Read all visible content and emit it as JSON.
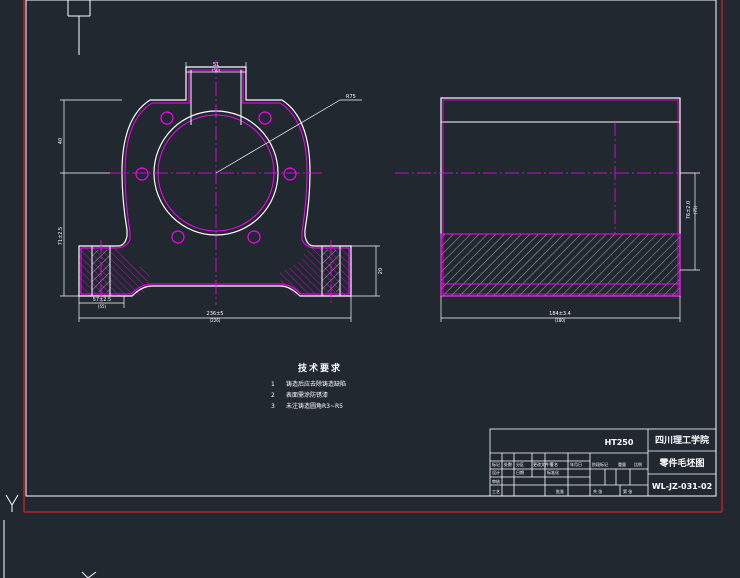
{
  "drawing": {
    "material": "HT250",
    "school": "四川理工学院",
    "drawing_title": "零件毛坯图",
    "drawing_number": "WL-JZ-031-02",
    "tech_title": "技术要求",
    "tech_nums": [
      "1",
      "2",
      "3"
    ],
    "tech_items": [
      "铸造后应去除铸造缺陷",
      "表面需涂防锈漆",
      "未注铸造圆角R3~R5"
    ],
    "dims": {
      "d51": "51",
      "d51_sub": "(50)",
      "r75": "R75",
      "d40": "40",
      "d73": "73",
      "h71": "71±2.5",
      "h20": "20",
      "d28": "28",
      "w_bottom": "236±5",
      "w_bottom_sub": "(226)",
      "w_seg": "57±2.5",
      "w_seg_sub": "(55)",
      "right_h": "76±2.0",
      "right_h2": "(75)",
      "right_w": "184±3.4",
      "right_w_sub": "(180)"
    },
    "title_block": {
      "r1": [
        "标记",
        "处数",
        "分区",
        "更改文件号",
        "签名",
        "年月日"
      ],
      "r2": [
        "设计",
        "日期",
        "标准化"
      ],
      "r2b": [
        "阶段标记",
        "重量",
        "比例"
      ],
      "r3": [
        "审核"
      ],
      "r4": [
        "工艺",
        "批准",
        "共 张",
        "第 张"
      ]
    }
  },
  "colors": {
    "background": "#212830",
    "line": "#ffffff",
    "center": "#ff00ff",
    "frame_red": "#ff2020"
  }
}
